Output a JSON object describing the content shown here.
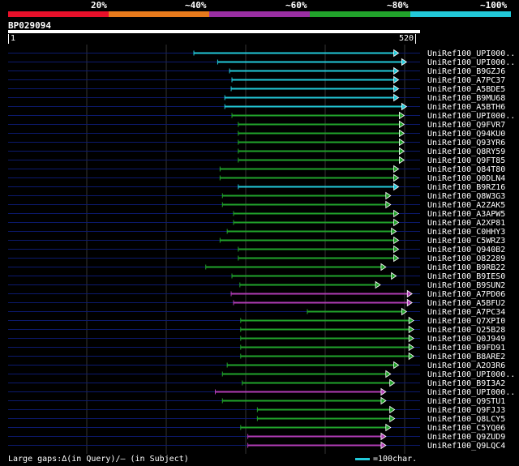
{
  "scale": {
    "labels": [
      "20%",
      "~40%",
      "~60%",
      "~80%",
      "~100%"
    ],
    "colors": [
      "#e8102a",
      "#e87a1c",
      "#9a2fa3",
      "#21a32b",
      "#22c9d9"
    ]
  },
  "query": {
    "id": "BP029094",
    "start": "1",
    "end": "520"
  },
  "hits": [
    {
      "name": "UniRef100_UPI000..",
      "start": 235,
      "end": 493,
      "color": "#22c9d9"
    },
    {
      "name": "UniRef100_UPI000..",
      "start": 265,
      "end": 503,
      "color": "#22c9d9"
    },
    {
      "name": "UniRef100_B9GZJ6",
      "start": 280,
      "end": 493,
      "color": "#22c9d9"
    },
    {
      "name": "UniRef100_A7PC37",
      "start": 283,
      "end": 493,
      "color": "#22c9d9"
    },
    {
      "name": "UniRef100_A5BDE5",
      "start": 282,
      "end": 493,
      "color": "#22c9d9"
    },
    {
      "name": "UniRef100_B9MU68",
      "start": 274,
      "end": 493,
      "color": "#22c9d9"
    },
    {
      "name": "UniRef100_A5BTH6",
      "start": 274,
      "end": 503,
      "color": "#22c9d9"
    },
    {
      "name": "UniRef100_UPI000..",
      "start": 283,
      "end": 500,
      "color": "#21a32b"
    },
    {
      "name": "UniRef100_Q9FVR7",
      "start": 291,
      "end": 500,
      "color": "#21a32b"
    },
    {
      "name": "UniRef100_Q94KU0",
      "start": 291,
      "end": 500,
      "color": "#21a32b"
    },
    {
      "name": "UniRef100_Q93YR6",
      "start": 291,
      "end": 500,
      "color": "#21a32b"
    },
    {
      "name": "UniRef100_Q8RY59",
      "start": 291,
      "end": 500,
      "color": "#21a32b"
    },
    {
      "name": "UniRef100_Q9FT85",
      "start": 291,
      "end": 500,
      "color": "#21a32b"
    },
    {
      "name": "UniRef100_Q84T80",
      "start": 268,
      "end": 493,
      "color": "#21a32b"
    },
    {
      "name": "UniRef100_Q0DLN4",
      "start": 268,
      "end": 493,
      "color": "#21a32b"
    },
    {
      "name": "UniRef100_B9RZ16",
      "start": 291,
      "end": 493,
      "color": "#22c9d9"
    },
    {
      "name": "UniRef100_Q8W3G3",
      "start": 271,
      "end": 483,
      "color": "#21a32b"
    },
    {
      "name": "UniRef100_A2ZAK5",
      "start": 271,
      "end": 483,
      "color": "#21a32b"
    },
    {
      "name": "UniRef100_A3APW5",
      "start": 285,
      "end": 493,
      "color": "#21a32b"
    },
    {
      "name": "UniRef100_A2XP81",
      "start": 285,
      "end": 493,
      "color": "#21a32b"
    },
    {
      "name": "UniRef100_C0HHY3",
      "start": 277,
      "end": 490,
      "color": "#21a32b"
    },
    {
      "name": "UniRef100_C5WRZ3",
      "start": 268,
      "end": 493,
      "color": "#21a32b"
    },
    {
      "name": "UniRef100_Q940B2",
      "start": 291,
      "end": 493,
      "color": "#21a32b"
    },
    {
      "name": "UniRef100_O82289",
      "start": 291,
      "end": 493,
      "color": "#21a32b"
    },
    {
      "name": "UniRef100_B9RB22",
      "start": 250,
      "end": 477,
      "color": "#21a32b"
    },
    {
      "name": "UniRef100_B9IES0",
      "start": 283,
      "end": 490,
      "color": "#21a32b"
    },
    {
      "name": "UniRef100_B9SUN2",
      "start": 293,
      "end": 470,
      "color": "#21a32b"
    },
    {
      "name": "UniRef100_A7PD06",
      "start": 282,
      "end": 510,
      "color": "#b03cb5"
    },
    {
      "name": "UniRef100_A5BFU2",
      "start": 285,
      "end": 510,
      "color": "#b03cb5"
    },
    {
      "name": "UniRef100_A7PC34",
      "start": 378,
      "end": 503,
      "color": "#21a32b"
    },
    {
      "name": "UniRef100_Q7XPI0",
      "start": 294,
      "end": 512,
      "color": "#21a32b"
    },
    {
      "name": "UniRef100_Q25B28",
      "start": 294,
      "end": 512,
      "color": "#21a32b"
    },
    {
      "name": "UniRef100_Q0J949",
      "start": 294,
      "end": 512,
      "color": "#21a32b"
    },
    {
      "name": "UniRef100_B9FD91",
      "start": 294,
      "end": 512,
      "color": "#21a32b"
    },
    {
      "name": "UniRef100_B8ARE2",
      "start": 294,
      "end": 512,
      "color": "#21a32b"
    },
    {
      "name": "UniRef100_A2O3R6",
      "start": 277,
      "end": 493,
      "color": "#21a32b"
    },
    {
      "name": "UniRef100_UPI000..",
      "start": 271,
      "end": 483,
      "color": "#21a32b"
    },
    {
      "name": "UniRef100_B9I3A2",
      "start": 296,
      "end": 488,
      "color": "#21a32b"
    },
    {
      "name": "UniRef100_UPI000..",
      "start": 262,
      "end": 477,
      "color": "#b03cb5"
    },
    {
      "name": "UniRef100_Q9STU1",
      "start": 271,
      "end": 477,
      "color": "#21a32b"
    },
    {
      "name": "UniRef100_Q9FJJ3",
      "start": 315,
      "end": 488,
      "color": "#21a32b"
    },
    {
      "name": "UniRef100_Q8LCY5",
      "start": 315,
      "end": 488,
      "color": "#21a32b"
    },
    {
      "name": "UniRef100_C5YQ06",
      "start": 294,
      "end": 483,
      "color": "#21a32b"
    },
    {
      "name": "UniRef100_Q9ZUD9",
      "start": 303,
      "end": 477,
      "color": "#b03cb5"
    },
    {
      "name": "UniRef100_Q9LQC4",
      "start": 303,
      "end": 477,
      "color": "#b03cb5"
    }
  ],
  "footer": {
    "gaps": "Large gaps:∆(in Query)/– (in Subject)",
    "legend": "=100char."
  }
}
